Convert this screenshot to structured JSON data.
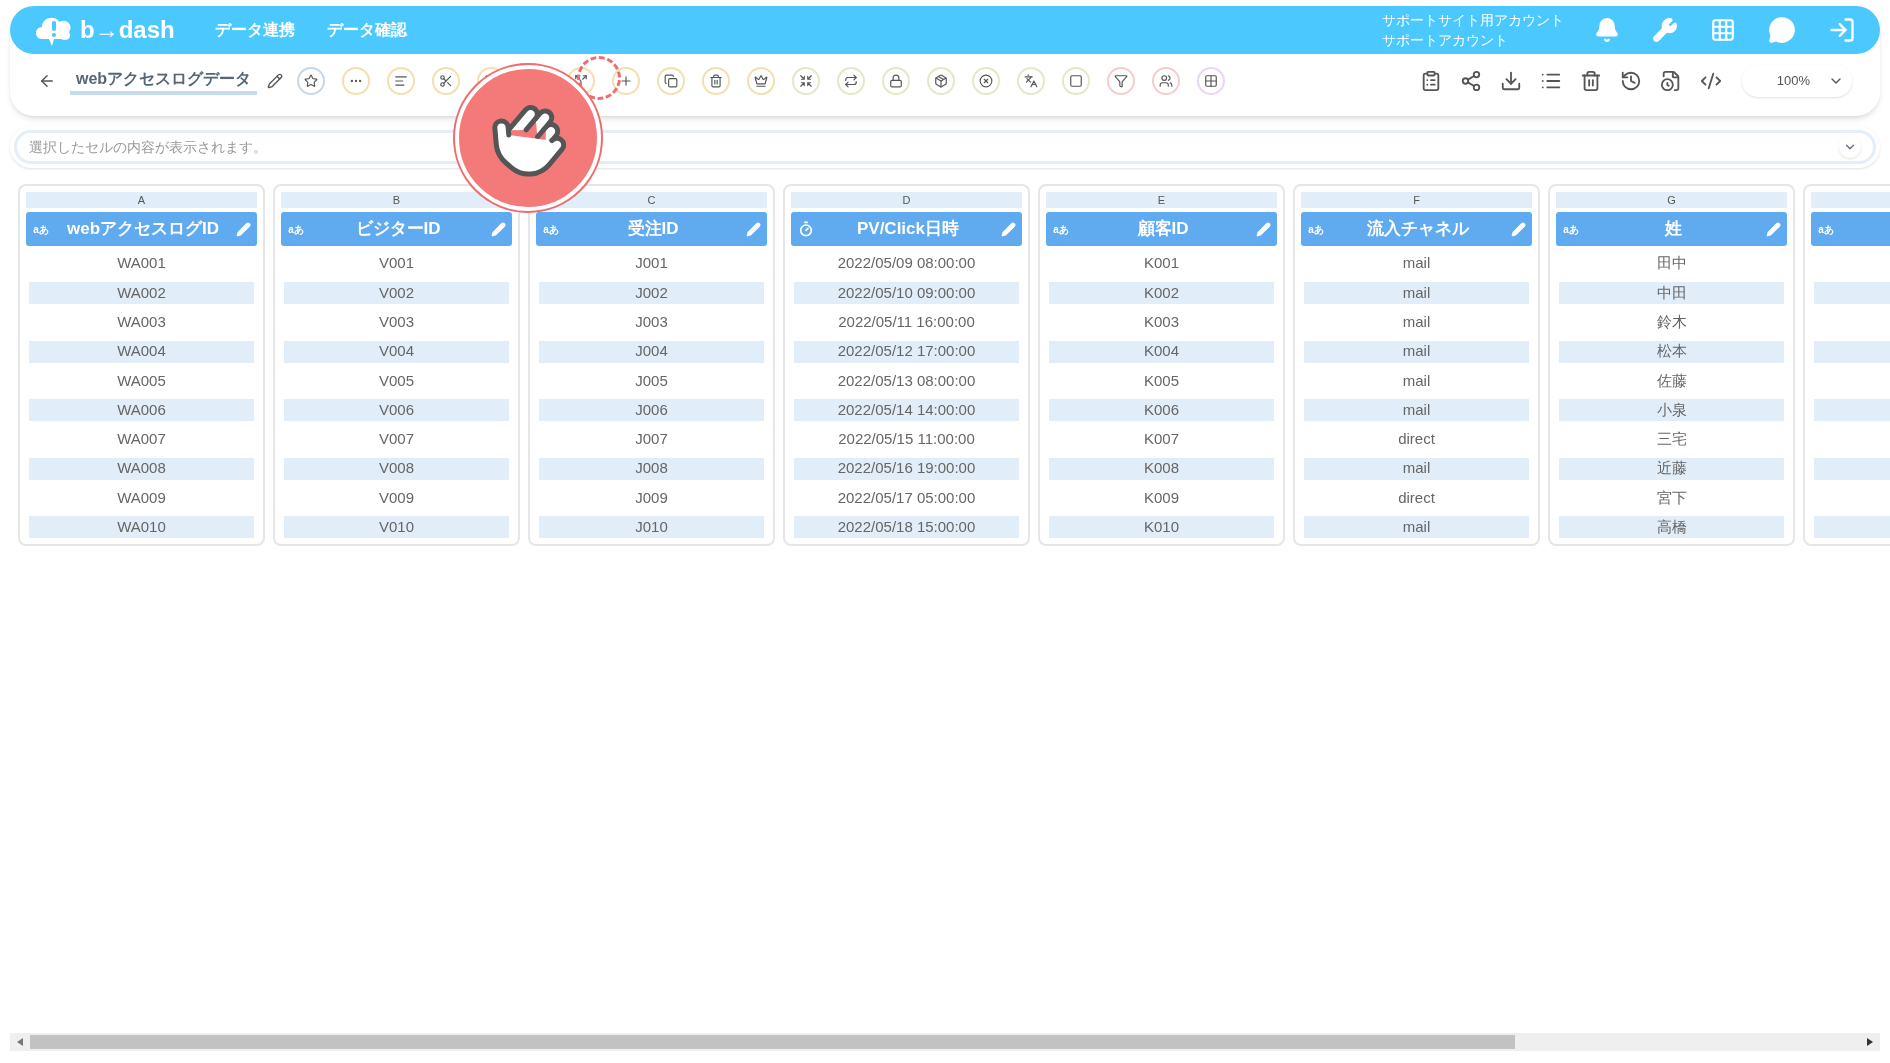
{
  "header": {
    "logo": "b→dash",
    "nav": [
      {
        "label": "データ連携"
      },
      {
        "label": "データ確認"
      }
    ],
    "account": {
      "site": "サポートサイト用アカウント",
      "name": "サポートアカウント"
    }
  },
  "toolbar": {
    "title": "webアクセスログデータ",
    "zoom": "100%"
  },
  "cell_viewer": {
    "placeholder": "選択したセルの内容が表示されます。"
  },
  "columns": [
    {
      "letter": "A",
      "kind": "text",
      "type_badge": "aあ",
      "name": "webアクセスログID",
      "values": [
        "WA001",
        "WA002",
        "WA003",
        "WA004",
        "WA005",
        "WA006",
        "WA007",
        "WA008",
        "WA009",
        "WA010"
      ]
    },
    {
      "letter": "B",
      "kind": "text",
      "type_badge": "aあ",
      "name": "ビジターID",
      "values": [
        "V001",
        "V002",
        "V003",
        "V004",
        "V005",
        "V006",
        "V007",
        "V008",
        "V009",
        "V010"
      ]
    },
    {
      "letter": "C",
      "kind": "text",
      "type_badge": "aあ",
      "name": "受注ID",
      "values": [
        "J001",
        "J002",
        "J003",
        "J004",
        "J005",
        "J006",
        "J007",
        "J008",
        "J009",
        "J010"
      ]
    },
    {
      "letter": "D",
      "kind": "datetime",
      "name": "PV/Click日時",
      "values": [
        "2022/05/09 08:00:00",
        "2022/05/10 09:00:00",
        "2022/05/11 16:00:00",
        "2022/05/12 17:00:00",
        "2022/05/13 08:00:00",
        "2022/05/14 14:00:00",
        "2022/05/15 11:00:00",
        "2022/05/16 19:00:00",
        "2022/05/17 05:00:00",
        "2022/05/18 15:00:00"
      ]
    },
    {
      "letter": "E",
      "kind": "text",
      "type_badge": "aあ",
      "name": "顧客ID",
      "values": [
        "K001",
        "K002",
        "K003",
        "K004",
        "K005",
        "K006",
        "K007",
        "K008",
        "K009",
        "K010"
      ]
    },
    {
      "letter": "F",
      "kind": "text",
      "type_badge": "aあ",
      "name": "流入チャネル",
      "values": [
        "mail",
        "mail",
        "mail",
        "mail",
        "mail",
        "mail",
        "direct",
        "mail",
        "direct",
        "mail"
      ]
    },
    {
      "letter": "G",
      "kind": "text",
      "type_badge": "aあ",
      "name": "姓",
      "values": [
        "田中",
        "中田",
        "鈴木",
        "松本",
        "佐藤",
        "小泉",
        "三宅",
        "近藤",
        "宮下",
        "高橋"
      ]
    },
    {
      "kind": "text",
      "type_badge": "aあ"
    }
  ]
}
